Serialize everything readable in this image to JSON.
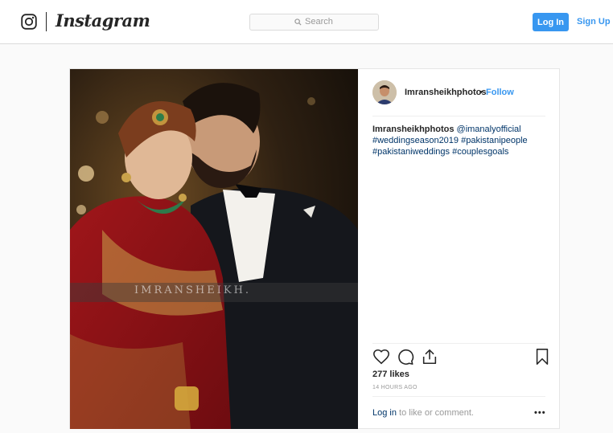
{
  "nav": {
    "brand": "Instagram",
    "search_placeholder": "Search",
    "login_label": "Log In",
    "signup_label": "Sign Up",
    "accent_color": "#3897f0"
  },
  "post": {
    "image_watermark": "IMRANSHEIKH.",
    "username": "Imransheikhphotos",
    "separator": "•",
    "follow_label": "Follow",
    "caption": {
      "username": "Imransheikhphotos",
      "mention": "@imanalyofficial",
      "hashtags": [
        "#weddingseason2019",
        "#pakistanipeople",
        "#pakistaniweddings",
        "#couplesgoals"
      ]
    },
    "actions": {
      "like_icon": "heart-icon",
      "comment_icon": "comment-icon",
      "share_icon": "share-icon",
      "save_icon": "bookmark-icon"
    },
    "likes_text": "277 likes",
    "timestamp": "14 HOURS AGO",
    "login_link_label": "Log in",
    "comment_prompt": " to like or comment.",
    "more_label": "•••"
  }
}
